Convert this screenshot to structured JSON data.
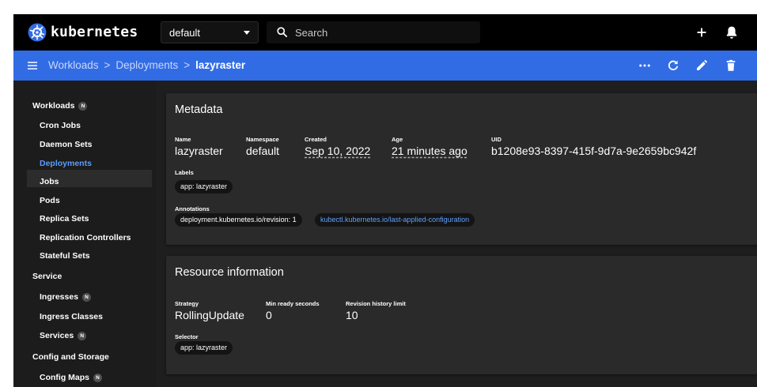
{
  "topbar": {
    "brand": "kubernetes",
    "namespace": "default",
    "search_placeholder": "Search",
    "icons": [
      "kubernetes-logo-icon",
      "search-icon",
      "plus-icon",
      "bell-icon"
    ]
  },
  "breadcrumb": {
    "items": [
      "Workloads",
      "Deployments",
      "lazyraster"
    ],
    "separator": ">",
    "icons": [
      "menu-icon",
      "more-horizontal-icon",
      "refresh-icon",
      "edit-pencil-icon",
      "delete-trash-icon"
    ]
  },
  "sidebar": {
    "badge": "N",
    "sections": [
      {
        "label": "Workloads",
        "badge": "N",
        "items": [
          {
            "label": "Cron Jobs"
          },
          {
            "label": "Daemon Sets"
          },
          {
            "label": "Deployments",
            "active": true
          },
          {
            "label": "Jobs"
          },
          {
            "label": "Pods"
          },
          {
            "label": "Replica Sets"
          },
          {
            "label": "Replication Controllers"
          },
          {
            "label": "Stateful Sets"
          }
        ]
      },
      {
        "label": "Service",
        "items": [
          {
            "label": "Ingresses",
            "badge": "N"
          },
          {
            "label": "Ingress Classes"
          },
          {
            "label": "Services",
            "badge": "N"
          }
        ]
      },
      {
        "label": "Config and Storage",
        "items": [
          {
            "label": "Config Maps",
            "badge": "N"
          }
        ]
      }
    ]
  },
  "metadata": {
    "title": "Metadata",
    "name_label": "Name",
    "name": "lazyraster",
    "namespace_label": "Namespace",
    "namespace": "default",
    "created_label": "Created",
    "created": "Sep 10, 2022",
    "age_label": "Age",
    "age": "21 minutes ago",
    "uid_label": "UID",
    "uid": "b1208e93-8397-415f-9d7a-9e2659bc942f",
    "labels_label": "Labels",
    "labels": [
      "app: lazyraster"
    ],
    "annotations_label": "Annotations",
    "annotations": [
      "deployment.kubernetes.io/revision: 1",
      "kubectl.kubernetes.io/last-applied-configuration"
    ]
  },
  "resource": {
    "title": "Resource information",
    "strategy_label": "Strategy",
    "strategy": "RollingUpdate",
    "min_ready_label": "Min ready seconds",
    "min_ready": "0",
    "revision_limit_label": "Revision history limit",
    "revision_limit": "10",
    "selector_label": "Selector",
    "selector": [
      "app: lazyraster"
    ]
  },
  "colors": {
    "breadcrumb_bar": "#326ce5",
    "active_nav": "#5b9bff",
    "link_chip": "#61a0ff",
    "card": "#2a2a2a",
    "sidebar": "#1c1c1c"
  }
}
